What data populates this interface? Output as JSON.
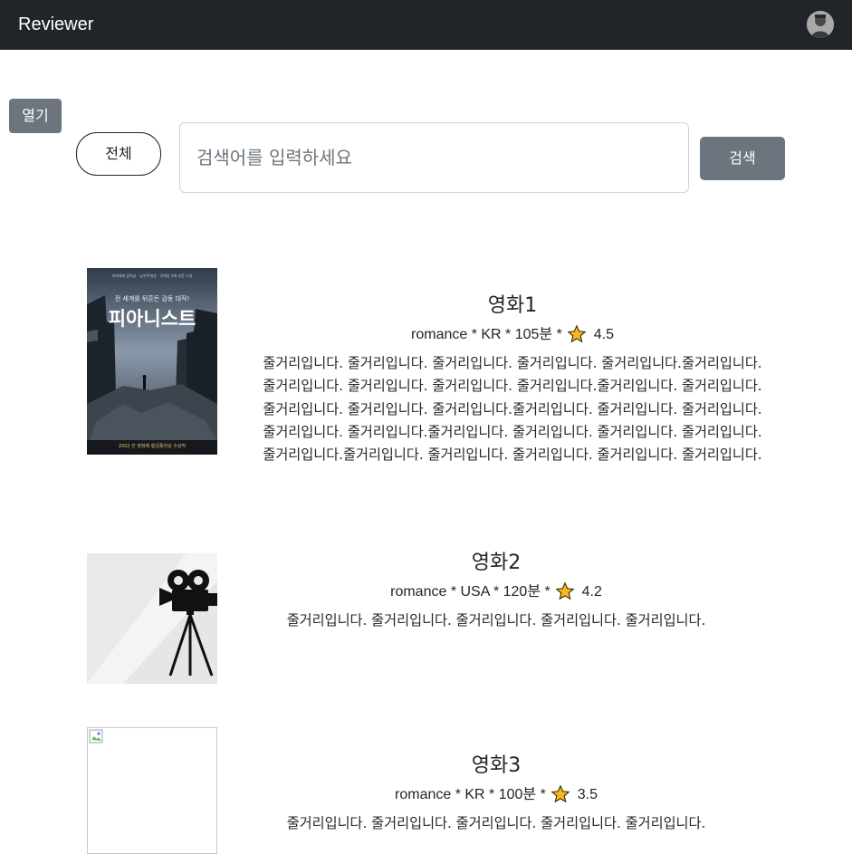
{
  "navbar": {
    "brand": "Reviewer",
    "avatar_icon": "user-avatar-icon"
  },
  "sidebar_toggle": {
    "label": "열기"
  },
  "filter": {
    "all_label": "전체"
  },
  "search": {
    "placeholder": "검색어를 입력하세요",
    "value": "",
    "button_label": "검색"
  },
  "colors": {
    "navbar": "#212529",
    "button_gray": "#6c757d",
    "star": "#f5b921"
  },
  "movies": [
    {
      "title": "영화1",
      "genre": "romance",
      "country": "KR",
      "runtime": "105분",
      "rating": "4.5",
      "meta": "romance * KR * 105분 *",
      "description": "줄거리입니다. 줄거리입니다. 줄거리입니다. 줄거리입니다. 줄거리입니다.줄거리입니다. 줄거리입니다. 줄거리입니다. 줄거리입니다. 줄거리입니다.줄거리입니다. 줄거리입니다. 줄거리입니다. 줄거리입니다. 줄거리입니다.줄거리입니다. 줄거리입니다. 줄거리입니다. 줄거리입니다. 줄거리입니다.줄거리입니다. 줄거리입니다. 줄거리입니다. 줄거리입니다. 줄거리입니다.줄거리입니다. 줄거리입니다. 줄거리입니다. 줄거리입니다. 줄거리입니다.",
      "poster": {
        "type": "war-film-poster",
        "title_text": "피아니스트",
        "tagline": "전 세계를 뒤흔든 감동 대작!",
        "topline": "아카데미 감독상 · 남우주연상 · 각색상 3개 부문 수상",
        "bottom": "2002 칸 영화제 황금종려상 수상작"
      }
    },
    {
      "title": "영화2",
      "genre": "romance",
      "country": "USA",
      "runtime": "120분",
      "rating": "4.2",
      "meta": "romance * USA * 120분 *",
      "description": "줄거리입니다. 줄거리입니다. 줄거리입니다. 줄거리입니다. 줄거리입니다.",
      "poster": {
        "type": "movie-camera-icon"
      }
    },
    {
      "title": "영화3",
      "genre": "romance",
      "country": "KR",
      "runtime": "100분",
      "rating": "3.5",
      "meta": "romance * KR * 100분 *",
      "description": "줄거리입니다. 줄거리입니다. 줄거리입니다. 줄거리입니다. 줄거리입니다.",
      "poster": {
        "type": "broken-image-icon"
      }
    }
  ]
}
